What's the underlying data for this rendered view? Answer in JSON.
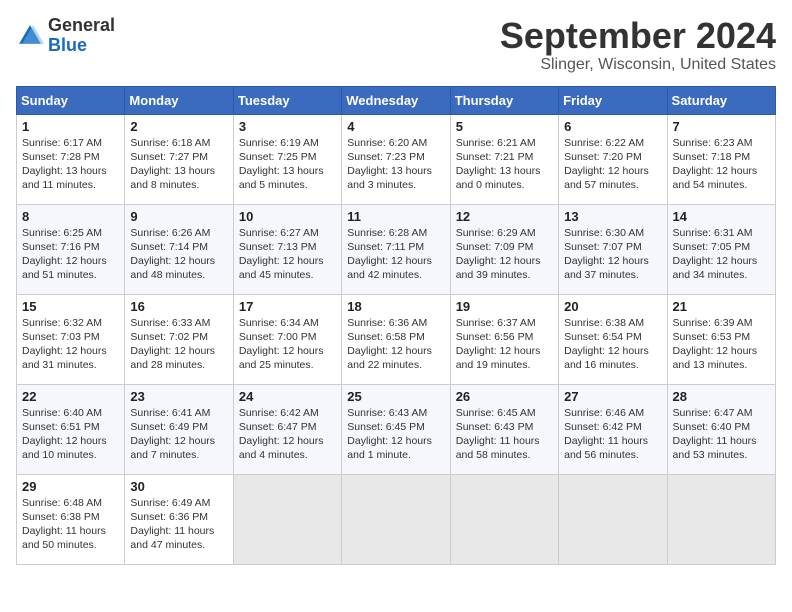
{
  "logo": {
    "general": "General",
    "blue": "Blue"
  },
  "title": "September 2024",
  "location": "Slinger, Wisconsin, United States",
  "days_of_week": [
    "Sunday",
    "Monday",
    "Tuesday",
    "Wednesday",
    "Thursday",
    "Friday",
    "Saturday"
  ],
  "weeks": [
    [
      {
        "day": 1,
        "info": "Sunrise: 6:17 AM\nSunset: 7:28 PM\nDaylight: 13 hours and 11 minutes."
      },
      {
        "day": 2,
        "info": "Sunrise: 6:18 AM\nSunset: 7:27 PM\nDaylight: 13 hours and 8 minutes."
      },
      {
        "day": 3,
        "info": "Sunrise: 6:19 AM\nSunset: 7:25 PM\nDaylight: 13 hours and 5 minutes."
      },
      {
        "day": 4,
        "info": "Sunrise: 6:20 AM\nSunset: 7:23 PM\nDaylight: 13 hours and 3 minutes."
      },
      {
        "day": 5,
        "info": "Sunrise: 6:21 AM\nSunset: 7:21 PM\nDaylight: 13 hours and 0 minutes."
      },
      {
        "day": 6,
        "info": "Sunrise: 6:22 AM\nSunset: 7:20 PM\nDaylight: 12 hours and 57 minutes."
      },
      {
        "day": 7,
        "info": "Sunrise: 6:23 AM\nSunset: 7:18 PM\nDaylight: 12 hours and 54 minutes."
      }
    ],
    [
      {
        "day": 8,
        "info": "Sunrise: 6:25 AM\nSunset: 7:16 PM\nDaylight: 12 hours and 51 minutes."
      },
      {
        "day": 9,
        "info": "Sunrise: 6:26 AM\nSunset: 7:14 PM\nDaylight: 12 hours and 48 minutes."
      },
      {
        "day": 10,
        "info": "Sunrise: 6:27 AM\nSunset: 7:13 PM\nDaylight: 12 hours and 45 minutes."
      },
      {
        "day": 11,
        "info": "Sunrise: 6:28 AM\nSunset: 7:11 PM\nDaylight: 12 hours and 42 minutes."
      },
      {
        "day": 12,
        "info": "Sunrise: 6:29 AM\nSunset: 7:09 PM\nDaylight: 12 hours and 39 minutes."
      },
      {
        "day": 13,
        "info": "Sunrise: 6:30 AM\nSunset: 7:07 PM\nDaylight: 12 hours and 37 minutes."
      },
      {
        "day": 14,
        "info": "Sunrise: 6:31 AM\nSunset: 7:05 PM\nDaylight: 12 hours and 34 minutes."
      }
    ],
    [
      {
        "day": 15,
        "info": "Sunrise: 6:32 AM\nSunset: 7:03 PM\nDaylight: 12 hours and 31 minutes."
      },
      {
        "day": 16,
        "info": "Sunrise: 6:33 AM\nSunset: 7:02 PM\nDaylight: 12 hours and 28 minutes."
      },
      {
        "day": 17,
        "info": "Sunrise: 6:34 AM\nSunset: 7:00 PM\nDaylight: 12 hours and 25 minutes."
      },
      {
        "day": 18,
        "info": "Sunrise: 6:36 AM\nSunset: 6:58 PM\nDaylight: 12 hours and 22 minutes."
      },
      {
        "day": 19,
        "info": "Sunrise: 6:37 AM\nSunset: 6:56 PM\nDaylight: 12 hours and 19 minutes."
      },
      {
        "day": 20,
        "info": "Sunrise: 6:38 AM\nSunset: 6:54 PM\nDaylight: 12 hours and 16 minutes."
      },
      {
        "day": 21,
        "info": "Sunrise: 6:39 AM\nSunset: 6:53 PM\nDaylight: 12 hours and 13 minutes."
      }
    ],
    [
      {
        "day": 22,
        "info": "Sunrise: 6:40 AM\nSunset: 6:51 PM\nDaylight: 12 hours and 10 minutes."
      },
      {
        "day": 23,
        "info": "Sunrise: 6:41 AM\nSunset: 6:49 PM\nDaylight: 12 hours and 7 minutes."
      },
      {
        "day": 24,
        "info": "Sunrise: 6:42 AM\nSunset: 6:47 PM\nDaylight: 12 hours and 4 minutes."
      },
      {
        "day": 25,
        "info": "Sunrise: 6:43 AM\nSunset: 6:45 PM\nDaylight: 12 hours and 1 minute."
      },
      {
        "day": 26,
        "info": "Sunrise: 6:45 AM\nSunset: 6:43 PM\nDaylight: 11 hours and 58 minutes."
      },
      {
        "day": 27,
        "info": "Sunrise: 6:46 AM\nSunset: 6:42 PM\nDaylight: 11 hours and 56 minutes."
      },
      {
        "day": 28,
        "info": "Sunrise: 6:47 AM\nSunset: 6:40 PM\nDaylight: 11 hours and 53 minutes."
      }
    ],
    [
      {
        "day": 29,
        "info": "Sunrise: 6:48 AM\nSunset: 6:38 PM\nDaylight: 11 hours and 50 minutes."
      },
      {
        "day": 30,
        "info": "Sunrise: 6:49 AM\nSunset: 6:36 PM\nDaylight: 11 hours and 47 minutes."
      },
      null,
      null,
      null,
      null,
      null
    ]
  ]
}
